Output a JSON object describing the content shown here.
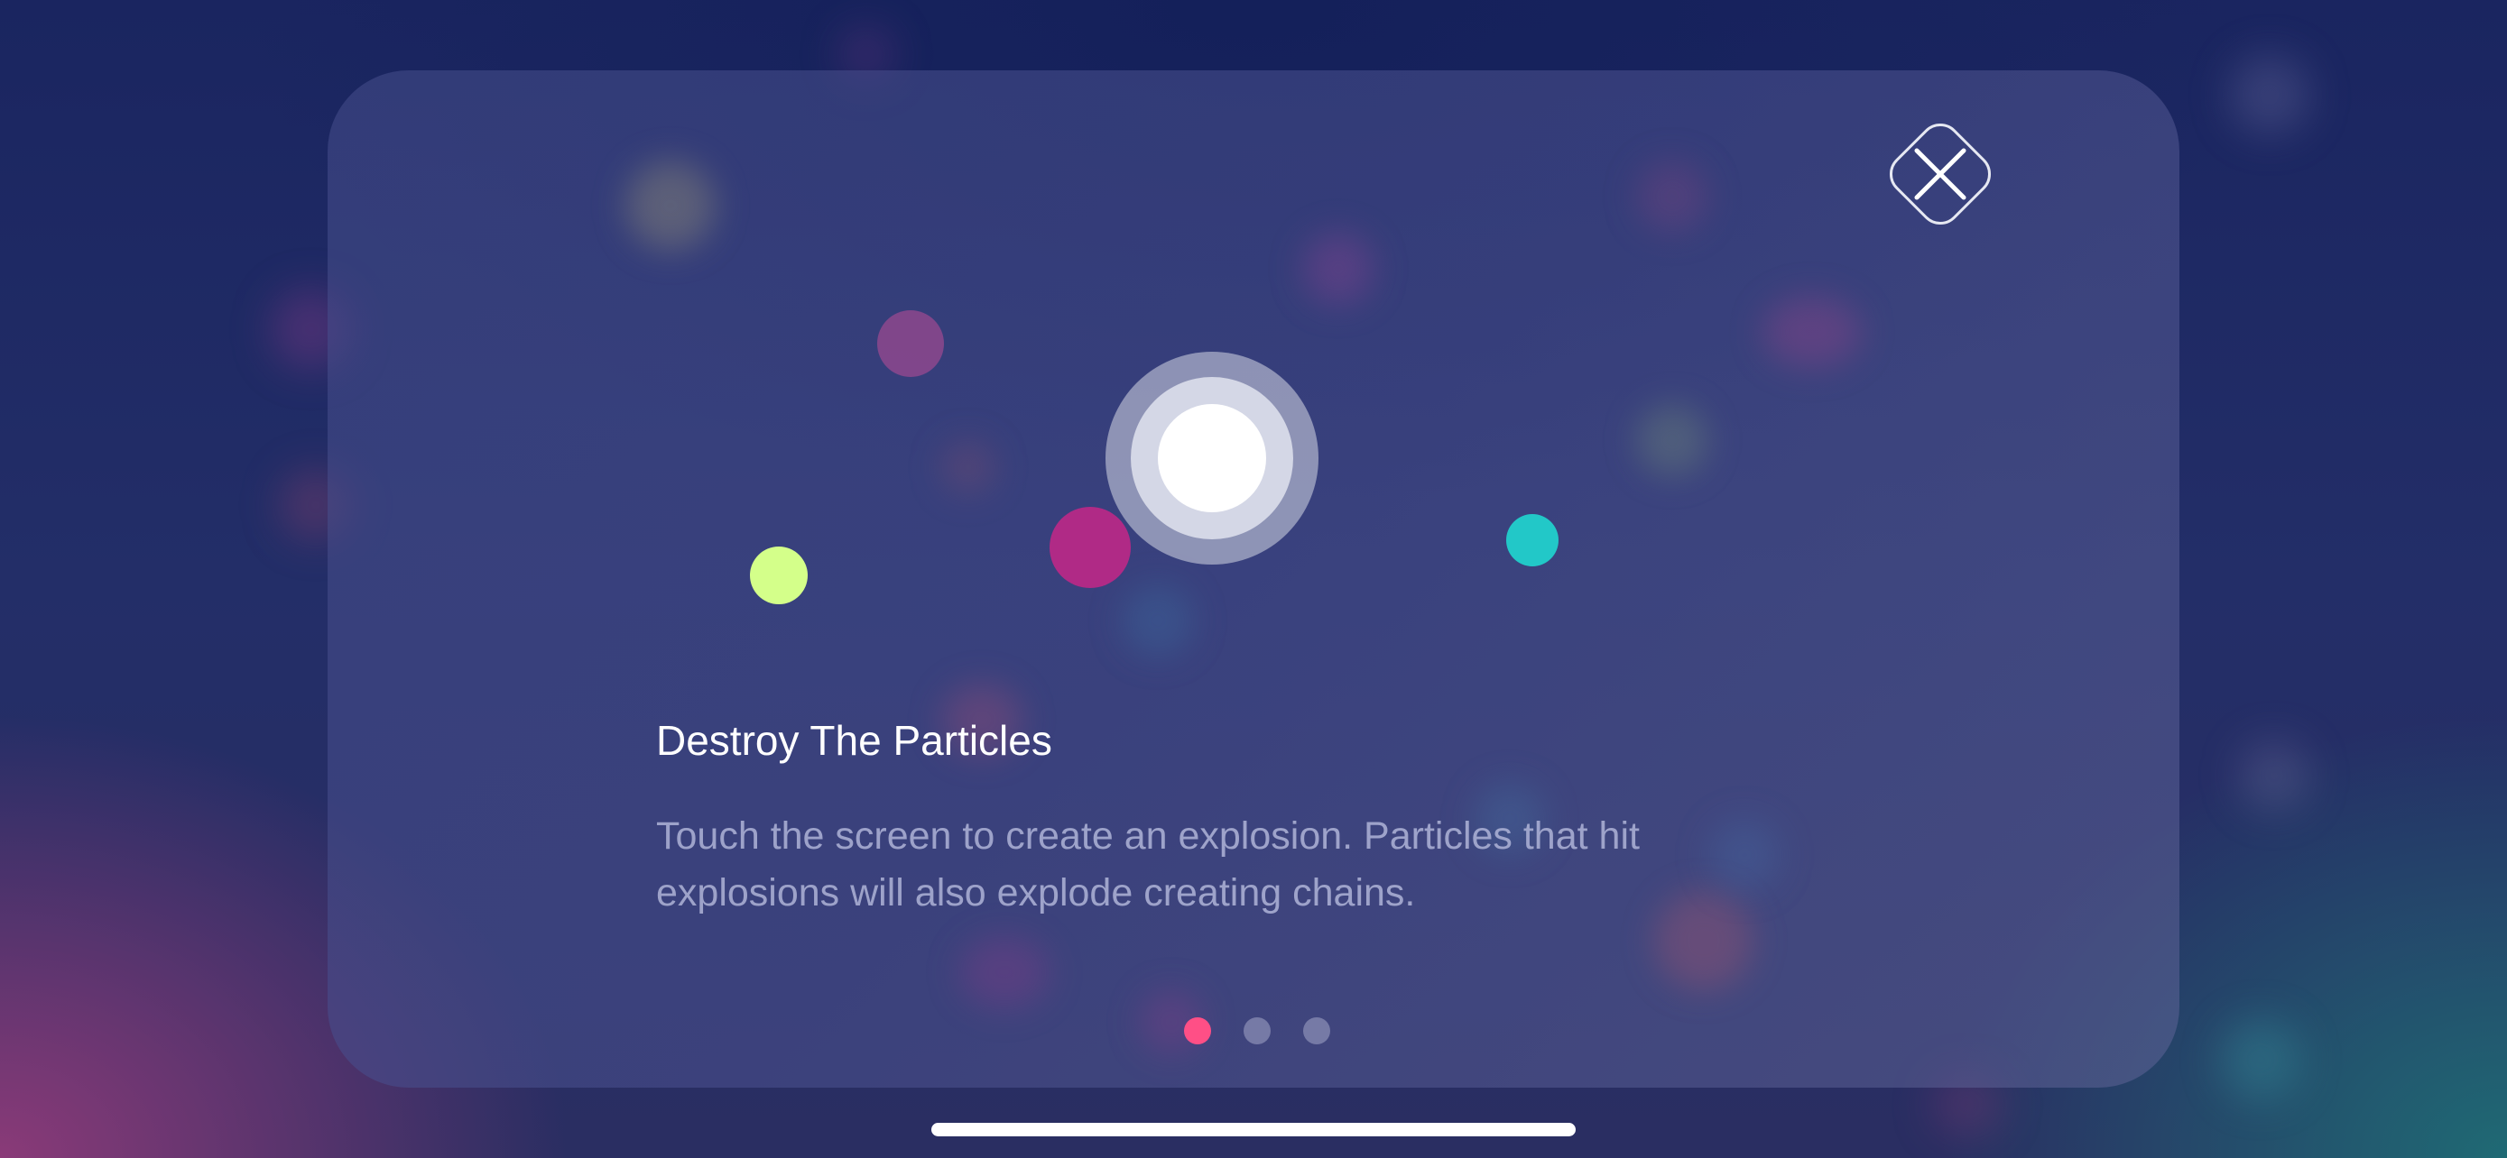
{
  "tutorial": {
    "title": "Destroy The Particles",
    "description": "Touch the screen to create an explosion. Particles that hit explosions will also explode creating chains.",
    "page_count": 3,
    "current_page": 1
  },
  "close_button": {
    "icon": "close-icon"
  },
  "colors": {
    "particle_purple": "#9a4a90",
    "particle_lime": "#d4ff8a",
    "particle_magenta": "#b02a86",
    "particle_cyan": "#22c8c8",
    "pager_active": "#ff4f86",
    "pager_inactive": "#767aa6"
  }
}
